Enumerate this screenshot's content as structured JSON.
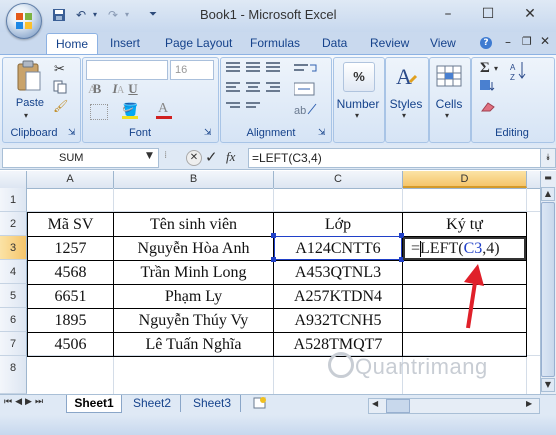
{
  "window": {
    "title": "Book1 - Microsoft Excel"
  },
  "ribbon": {
    "tabs": [
      "Home",
      "Insert",
      "Page Layout",
      "Formulas",
      "Data",
      "Review",
      "View"
    ],
    "font_size": "16",
    "groups": {
      "clipboard": "Clipboard",
      "font": "Font",
      "alignment": "Alignment",
      "editing": "Editing"
    },
    "buttons": {
      "paste": "Paste",
      "number": "Number",
      "styles": "Styles",
      "cells": "Cells",
      "percent": "%",
      "sigma": "Σ",
      "bold": "B",
      "italic": "I",
      "underline": "U"
    }
  },
  "formula_bar": {
    "name_box": "SUM",
    "fx": "fx",
    "formula": "=LEFT(C3,4)"
  },
  "grid": {
    "columns": [
      "A",
      "B",
      "C",
      "D"
    ],
    "rows": [
      "1",
      "2",
      "3",
      "4",
      "5",
      "6",
      "7",
      "8"
    ],
    "header": [
      "Mã SV",
      "Tên sinh viên",
      "Lớp",
      "Ký tự"
    ],
    "data": [
      [
        "1257",
        "Nguyễn Hòa Anh",
        "A124CNTT6"
      ],
      [
        "4568",
        "Trần Minh Long",
        "A453QTNL3"
      ],
      [
        "6651",
        "Phạm Ly",
        "A257KTDN4"
      ],
      [
        "1895",
        "Nguyễn Thúy Vy",
        "A932TCNH5"
      ],
      [
        "4506",
        "Lê Tuấn Nghĩa",
        "A528TMQT7"
      ]
    ],
    "edit_cell": {
      "prefix": "=LEFT(",
      "ref": "C3",
      "suffix": ",4)"
    }
  },
  "sheets": [
    "Sheet1",
    "Sheet2",
    "Sheet3"
  ],
  "watermark": "Quantrimang",
  "colors": {
    "arrow": "#e0202a",
    "ref_blue": "#2040c8",
    "ribbon_text": "#15428b"
  }
}
